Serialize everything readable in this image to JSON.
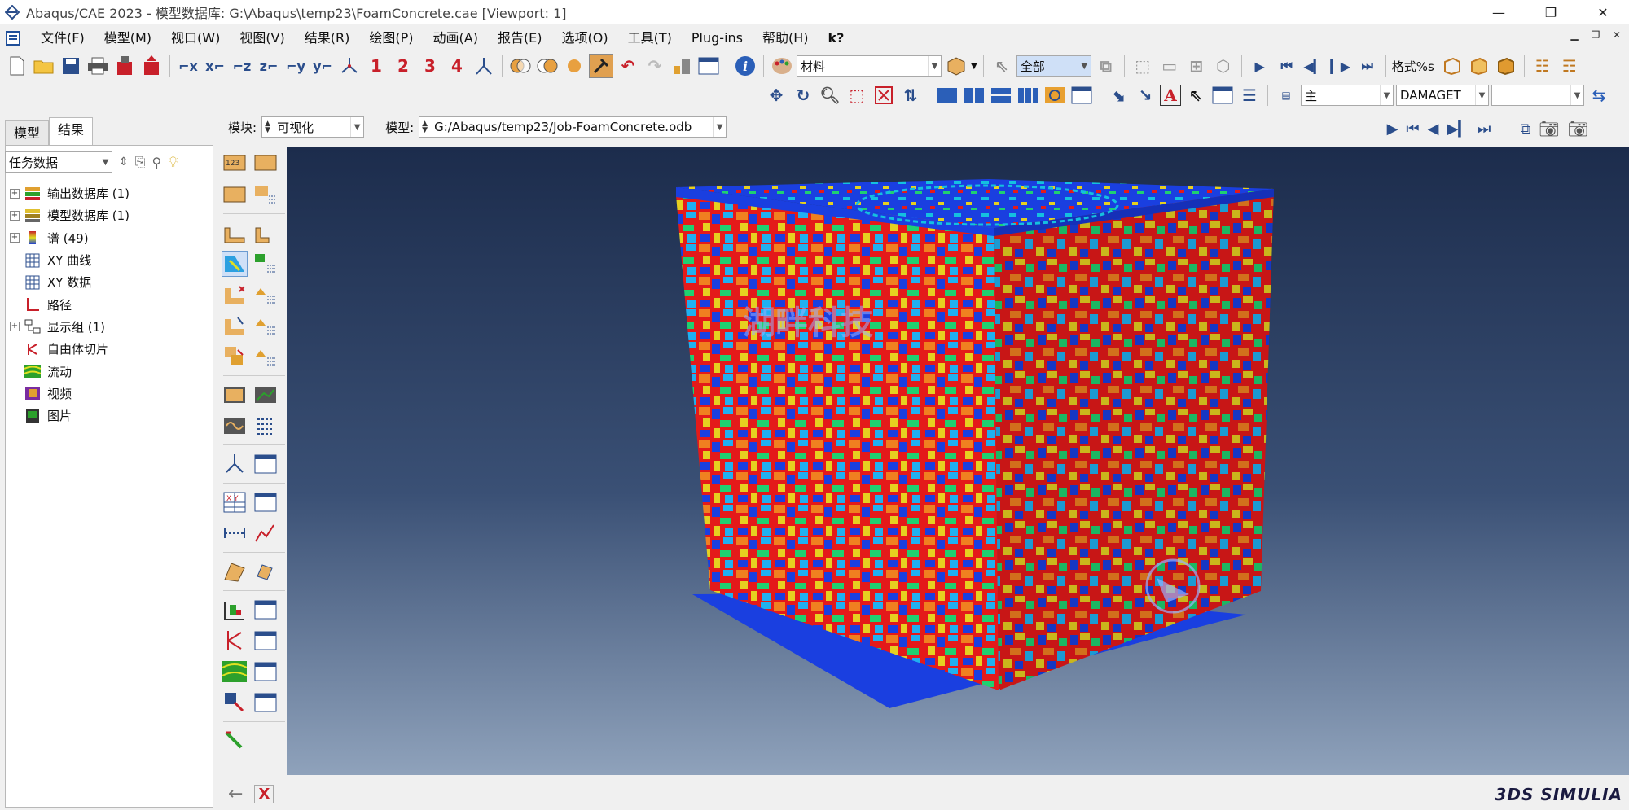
{
  "window": {
    "title": "Abaqus/CAE 2023 - 模型数据库: G:\\Abaqus\\temp23\\FoamConcrete.cae [Viewport: 1]",
    "minimize": "—",
    "maximize": "❐",
    "close": "✕"
  },
  "menu": {
    "items": [
      "文件(F)",
      "模型(M)",
      "视口(W)",
      "视图(V)",
      "结果(R)",
      "绘图(P)",
      "动画(A)",
      "报告(E)",
      "选项(O)",
      "工具(T)",
      "Plug-ins",
      "帮助(H)",
      "k?"
    ]
  },
  "toolbar": {
    "view_numbers": [
      "1",
      "2",
      "3",
      "4"
    ],
    "material_combo": "材料",
    "all_combo": "全部",
    "format_label": "格式%s",
    "main_combo": "主",
    "damage_combo": "DAMAGET",
    "empty_combo": ""
  },
  "tabs": [
    "模型",
    "结果"
  ],
  "filter": {
    "combo": "任务数据"
  },
  "tree": [
    {
      "label": "输出数据库 (1)",
      "expandable": true,
      "icon": "database-icon"
    },
    {
      "label": "模型数据库 (1)",
      "expandable": true,
      "icon": "database-icon"
    },
    {
      "label": "谱 (49)",
      "expandable": true,
      "icon": "spectrum-icon"
    },
    {
      "label": "XY 曲线",
      "expandable": false,
      "icon": "grid-icon"
    },
    {
      "label": "XY 数据",
      "expandable": false,
      "icon": "grid-icon"
    },
    {
      "label": "路径",
      "expandable": false,
      "icon": "path-icon"
    },
    {
      "label": "显示组 (1)",
      "expandable": true,
      "icon": "display-group-icon"
    },
    {
      "label": "自由体切片",
      "expandable": false,
      "icon": "free-body-icon"
    },
    {
      "label": "流动",
      "expandable": false,
      "icon": "streamline-icon"
    },
    {
      "label": "视频",
      "expandable": false,
      "icon": "movie-icon"
    },
    {
      "label": "图片",
      "expandable": false,
      "icon": "image-icon"
    }
  ],
  "context": {
    "module_label": "模块:",
    "module_value": "可视化",
    "model_label": "模型:",
    "model_value": "G:/Abaqus/temp23/Job-FoamConcrete.odb"
  },
  "viewport": {
    "watermark_text": "湖畔科技"
  },
  "prompt": {
    "back": "←",
    "cancel": "X"
  },
  "brand": "3DS SIMULIA",
  "colors": {
    "accent": "#1f4f9a",
    "contour_red": "#e41a1a",
    "contour_blue": "#1432d8"
  }
}
